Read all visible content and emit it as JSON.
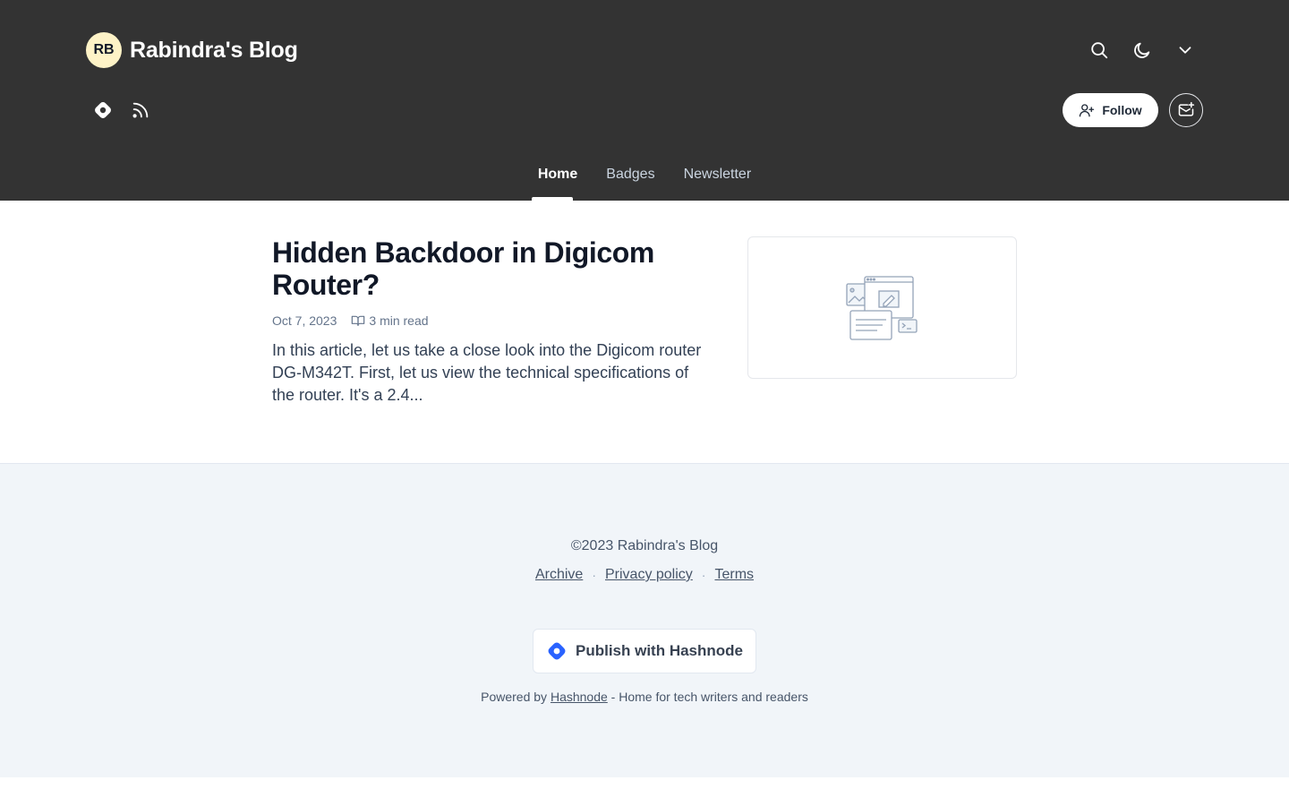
{
  "header": {
    "avatar_initials": "RB",
    "title": "Rabindra's Blog",
    "background_color": "#333333",
    "top_icons": [
      "search-icon",
      "moon-icon",
      "chevron-down-icon"
    ],
    "social_icons": [
      "hashnode-icon",
      "rss-icon"
    ],
    "follow_label": "Follow",
    "newsletter_icon": "mail-plus-icon"
  },
  "nav": {
    "items": [
      {
        "label": "Home",
        "active": true
      },
      {
        "label": "Badges",
        "active": false
      },
      {
        "label": "Newsletter",
        "active": false
      }
    ]
  },
  "post": {
    "title": "Hidden Backdoor in Digicom Router?",
    "date": "Oct 7, 2023",
    "read_time": "3 min read",
    "excerpt": "In this article, let us take a close look into the Digicom router DG-M342T. First, let us view the technical specifications of the router. It's a 2.4..."
  },
  "footer": {
    "copyright": "©2023 Rabindra's Blog",
    "links": [
      "Archive",
      "Privacy policy",
      "Terms"
    ],
    "separator": "·",
    "publish_label": "Publish with Hashnode",
    "powered_prefix": "Powered by ",
    "powered_link": "Hashnode",
    "powered_suffix": " - Home for tech writers and readers",
    "accent_color": "#2962ff"
  }
}
